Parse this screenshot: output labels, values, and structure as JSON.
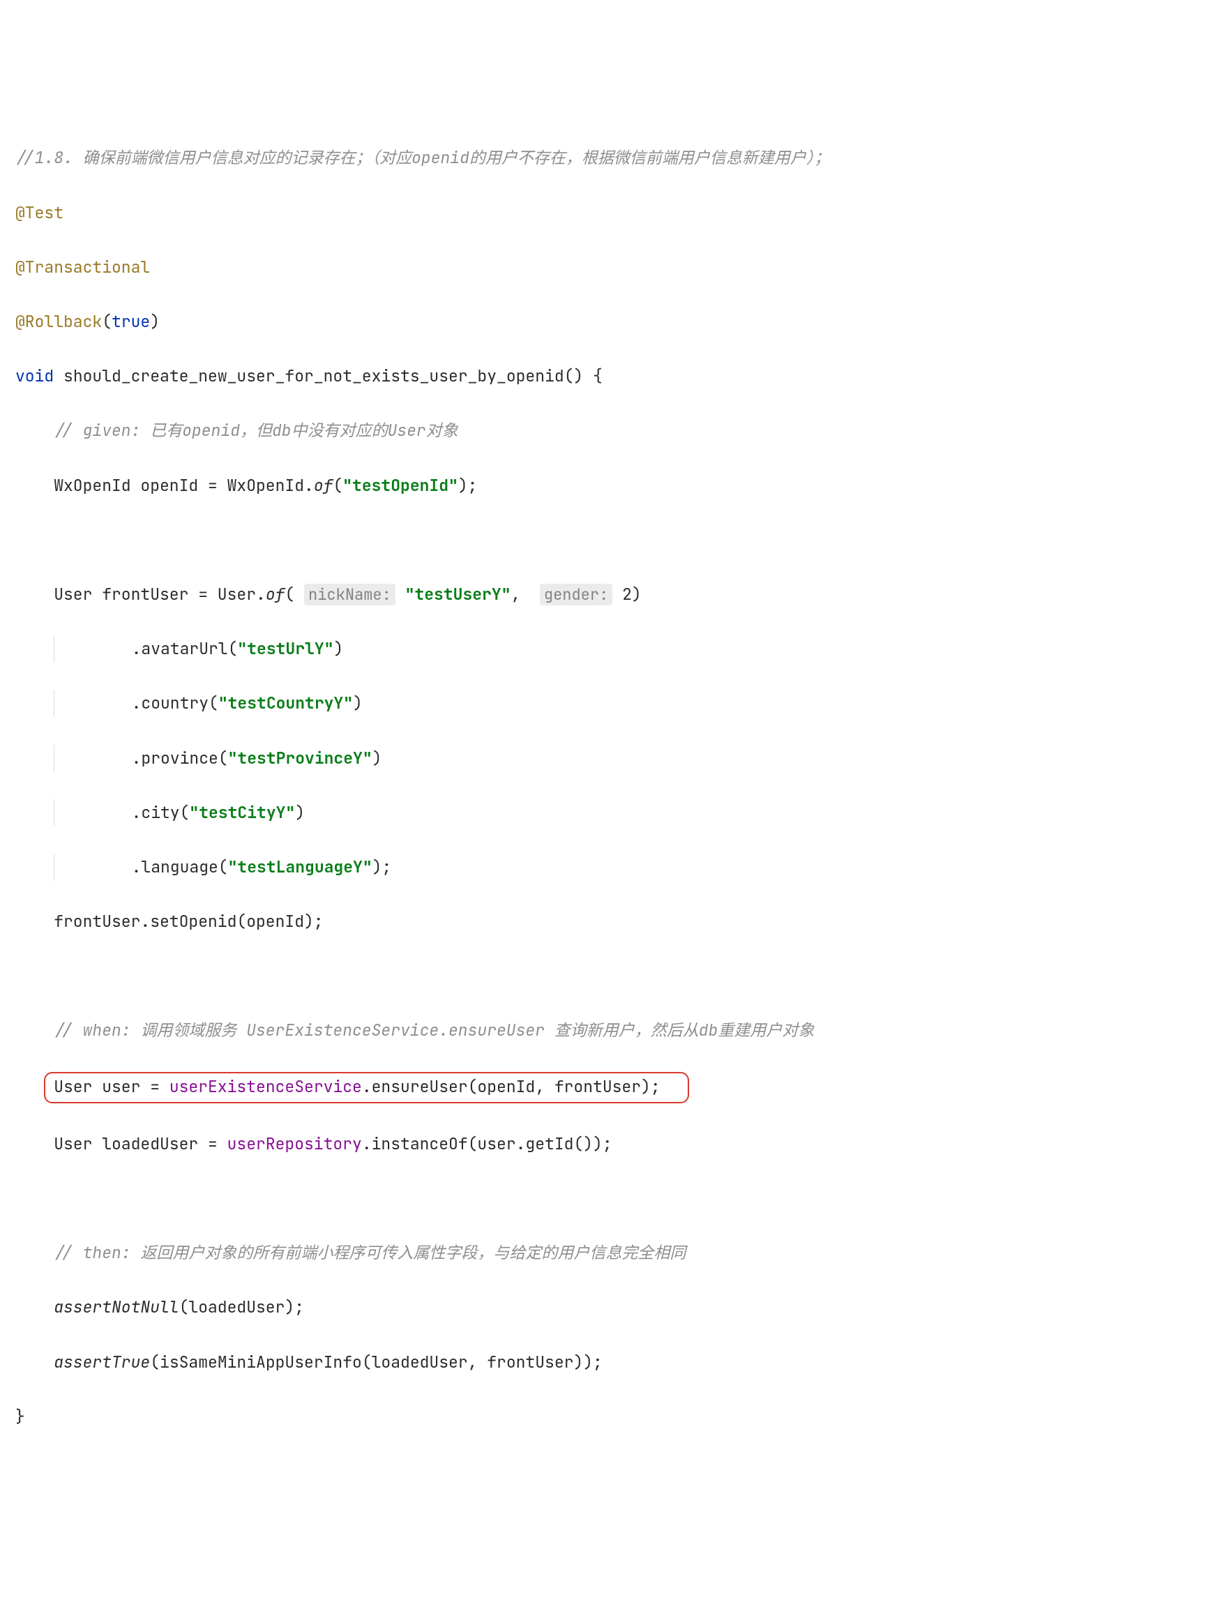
{
  "annotations": {
    "test": "@Test",
    "transactional": "@Transactional",
    "rollback": "@Rollback",
    "rollback_arg": "true"
  },
  "comments": {
    "header": "//1.8. 确保前端微信用户信息对应的记录存在；（对应openid的用户不存在，根据微信前端用户信息新建用户）；",
    "given": "// given: 已有openid，但db中没有对应的User对象",
    "when": "// when: 调用领域服务 UserExistenceService.ensureUser 查询新用户，然后从db重建用户对象",
    "then": "// then: 返回用户对象的所有前端小程序可传入属性字段，与给定的用户信息完全相同"
  },
  "keywords": {
    "void": "void"
  },
  "method_name": "should_create_new_user_for_not_exists_user_by_openid",
  "hints": {
    "nickName": "nickName:",
    "gender": "gender:"
  },
  "strings": {
    "testOpenId": "\"testOpenId\"",
    "testUserY": "\"testUserY\"",
    "testUrlY": "\"testUrlY\"",
    "testCountryY": "\"testCountryY\"",
    "testProvinceY": "\"testProvinceY\"",
    "testCityY": "\"testCityY\"",
    "testLanguageY": "\"testLanguageY\""
  },
  "code": {
    "openIdDecl": "WxOpenId openId = WxOpenId.",
    "of": "of",
    "frontUserDecl": "User frontUser = User.",
    "genderVal": "2",
    "avatarUrl": ".avatarUrl(",
    "country": ".country(",
    "province": ".province(",
    "city": ".city(",
    "language": ".language(",
    "setOpenid": "frontUser.setOpenid(openId);",
    "userDecl": "User user = ",
    "userExService": "userExistenceService",
    "ensureUser": ".ensureUser(openId, frontUser);",
    "loadedDecl": "User loadedUser = ",
    "userRepo": "userRepository",
    "instanceOf": ".instanceOf(user.getId());",
    "assertNotNull": "assertNotNull",
    "assertNotNullArg": "(loadedUser);",
    "assertTrue": "assertTrue",
    "assertTrueArg": "(isSameMiniAppUserInfo(loadedUser, frontUser));"
  }
}
